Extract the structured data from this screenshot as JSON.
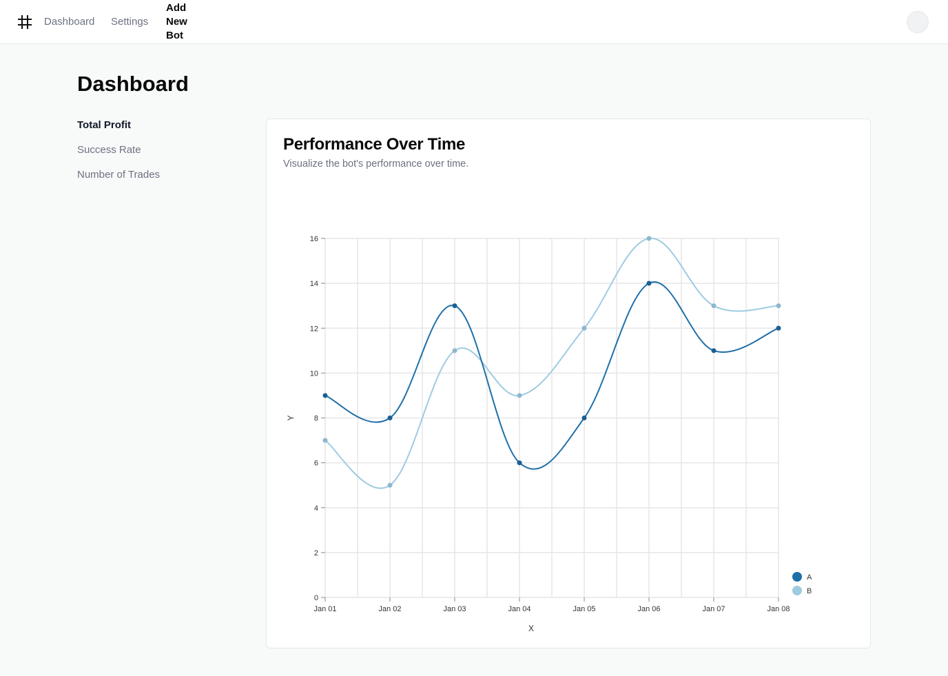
{
  "nav": {
    "logo_icon": "hash-icon",
    "dashboard": "Dashboard",
    "settings": "Settings",
    "add_bot": "Add New Bot"
  },
  "page": {
    "title": "Dashboard"
  },
  "sidebar": {
    "items": [
      {
        "label": "Total Profit",
        "active": true
      },
      {
        "label": "Success Rate",
        "active": false
      },
      {
        "label": "Number of Trades",
        "active": false
      }
    ]
  },
  "card": {
    "title": "Performance Over Time",
    "subtitle": "Visualize the bot's performance over time."
  },
  "chart_data": {
    "type": "line",
    "curve": "smooth",
    "x": [
      "Jan 01",
      "Jan 02",
      "Jan 03",
      "Jan 04",
      "Jan 05",
      "Jan 06",
      "Jan 07",
      "Jan 08"
    ],
    "series": [
      {
        "name": "A",
        "color": "#1f6fa8",
        "values": [
          9,
          8,
          13,
          6,
          8,
          14,
          11,
          12
        ]
      },
      {
        "name": "B",
        "color": "#9fcbe1",
        "values": [
          7,
          5,
          11,
          9,
          12,
          16,
          13,
          13
        ]
      }
    ],
    "xlabel": "X",
    "ylabel": "Y",
    "ylim": [
      0,
      16
    ],
    "yticks": [
      0,
      2,
      4,
      6,
      8,
      10,
      12,
      14,
      16
    ],
    "grid": true,
    "legend": "bottom-right"
  }
}
